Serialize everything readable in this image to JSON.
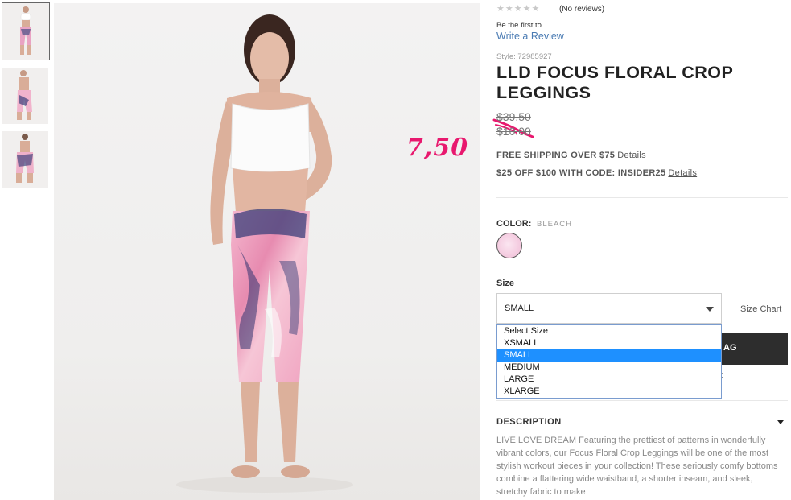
{
  "thumbnails": [
    {
      "alt": "thumbnail-front",
      "active": true
    },
    {
      "alt": "thumbnail-side",
      "active": false
    },
    {
      "alt": "thumbnail-back",
      "active": false
    }
  ],
  "annotation": {
    "handwritten_price": "7,50",
    "color": "#e8186e"
  },
  "reviews": {
    "stars": "★★★★★",
    "count_text": "(No reviews)",
    "prompt": "Be the first to",
    "link": "Write a Review"
  },
  "product": {
    "style": "Style: 72985927",
    "title": "LLD FOCUS FLORAL CROP LEGGINGS",
    "price_original": "$39.50",
    "price_sale": "$10.00"
  },
  "promos": [
    {
      "text": "FREE SHIPPING OVER $75",
      "link": "Details"
    },
    {
      "text": "$25 OFF $100 WITH CODE: INSIDER25",
      "link": "Details"
    }
  ],
  "color": {
    "label": "COLOR:",
    "value": "BLEACH",
    "swatch": "#f3c7dd"
  },
  "size": {
    "label": "Size",
    "selected": "SMALL",
    "chart_link": "Size Chart",
    "options": [
      "Select Size",
      "XSMALL",
      "SMALL",
      "MEDIUM",
      "LARGE",
      "XLARGE"
    ],
    "highlighted_option": "SMALL"
  },
  "actions": {
    "add_to_bag_partial": "AG",
    "wishlist_partial": "ilist"
  },
  "description": {
    "heading": "DESCRIPTION",
    "text": "LIVE LOVE DREAM Featuring the prettiest of patterns in wonderfully vibrant colors, our Focus Floral Crop Leggings will be one of the most stylish workout pieces in your collection! These seriously comfy bottoms combine a flattering wide waistband, a shorter inseam, and sleek, stretchy fabric to make"
  },
  "colors": {
    "accent": "#e8186e",
    "link": "#4a7bb3",
    "button": "#2d2d2d",
    "dropdown_highlight": "#1e90ff"
  }
}
